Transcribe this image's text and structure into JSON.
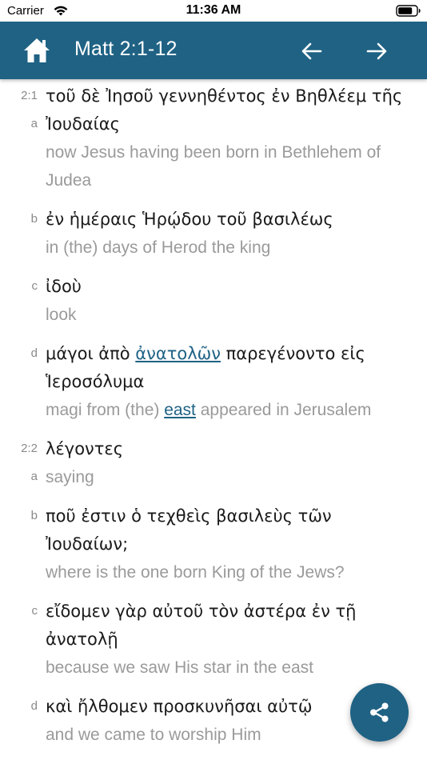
{
  "status_bar": {
    "carrier": "Carrier",
    "time": "11:36 AM"
  },
  "header": {
    "title": "Matt 2:1-12",
    "home_icon": "home-icon",
    "prev_icon": "arrow-left-icon",
    "next_icon": "arrow-right-icon",
    "background_color": "#1f6284"
  },
  "verses": [
    {
      "ref": "2:1",
      "clauses": [
        {
          "letter": "a",
          "greek": "τοῦ δὲ Ἰησοῦ γεννηθέντος ἐν Βηθλέεμ τῆς Ἰουδαίας",
          "english": "now Jesus having been born in Bethlehem of Judea"
        },
        {
          "letter": "b",
          "greek": "ἐν ἡμέραις Ἡρῴδου τοῦ βασιλέως",
          "english": "in (the) days of Herod the king"
        },
        {
          "letter": "c",
          "greek": "ἰδοὺ",
          "english": "look"
        },
        {
          "letter": "d",
          "greek_before": "μάγοι ἀπὸ ",
          "greek_link": "ἀνατολῶν",
          "greek_after": " παρεγένοντο εἰς Ἱεροσόλυμα",
          "english_before": "magi from (the) ",
          "english_link": "east",
          "english_after": " appeared in Jerusalem"
        }
      ]
    },
    {
      "ref": "2:2",
      "clauses": [
        {
          "letter": "a",
          "greek": "λέγοντες",
          "english": "saying"
        },
        {
          "letter": "b",
          "greek": "ποῦ ἐστιν ὁ τεχθεὶς βασιλεὺς τῶν Ἰουδαίων;",
          "english": "where is the one born King of the Jews?"
        },
        {
          "letter": "c",
          "greek": "εἴδομεν γὰρ αὐτοῦ τὸν ἀστέρα ἐν τῇ ἀνατολῇ",
          "english": "because we saw His star in the east"
        },
        {
          "letter": "d",
          "greek": "καὶ ἤλθομεν προσκυνῆσαι αὐτῷ",
          "english": "and we came to worship Him"
        }
      ]
    }
  ],
  "share_button": {
    "icon": "share-icon"
  }
}
